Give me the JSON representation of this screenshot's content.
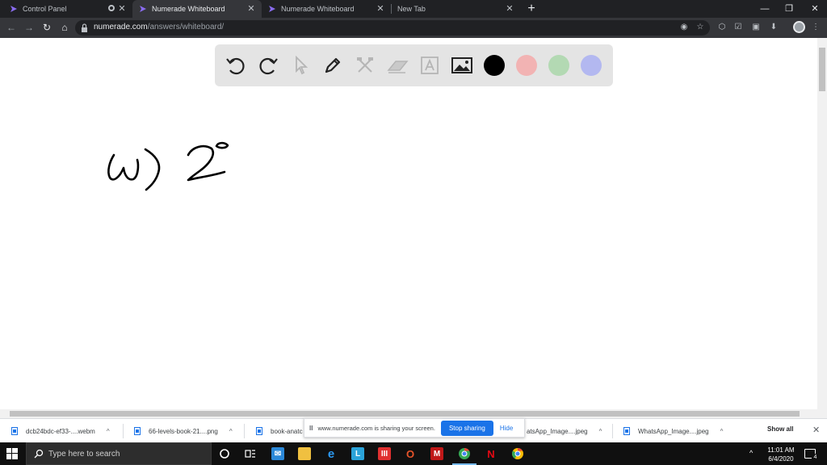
{
  "browser": {
    "tabs": [
      {
        "title": "Control Panel",
        "active": false
      },
      {
        "title": "Numerade Whiteboard",
        "active": true
      },
      {
        "title": "Numerade Whiteboard",
        "active": false
      },
      {
        "title": "New Tab",
        "active": false
      }
    ],
    "new_tab_label": "+",
    "window_controls": {
      "minimize": "—",
      "restore": "❐",
      "close": "✕"
    },
    "url_domain": "numerade.com",
    "url_path": "/answers/whiteboard/"
  },
  "whiteboard": {
    "tools": [
      "undo-icon",
      "redo-icon",
      "pointer-icon",
      "pen-icon",
      "tools-icon",
      "eraser-icon",
      "text-icon",
      "image-icon"
    ],
    "colors": [
      "#000000",
      "#f2b3b3",
      "#b3d9b3",
      "#b3b8f0"
    ],
    "ink_color": "#000000"
  },
  "downloads": {
    "items": [
      {
        "name": "dcb24bdc-ef33-....webm"
      },
      {
        "name": "66-levels-book-21....png"
      },
      {
        "name": "book-anatc"
      },
      {
        "name": "atsApp_Image....jpeg"
      },
      {
        "name": "WhatsApp_Image....jpeg"
      }
    ],
    "show_all": "Show all",
    "close": "✕"
  },
  "screen_share": {
    "pause": "II",
    "message": "www.numerade.com is sharing your screen.",
    "stop_label": "Stop sharing",
    "hide_label": "Hide"
  },
  "taskbar": {
    "search_placeholder": "Type here to search",
    "time": "11:01 AM",
    "date": "6/4/2020",
    "notification_count": "4",
    "tray_caret": "^"
  }
}
